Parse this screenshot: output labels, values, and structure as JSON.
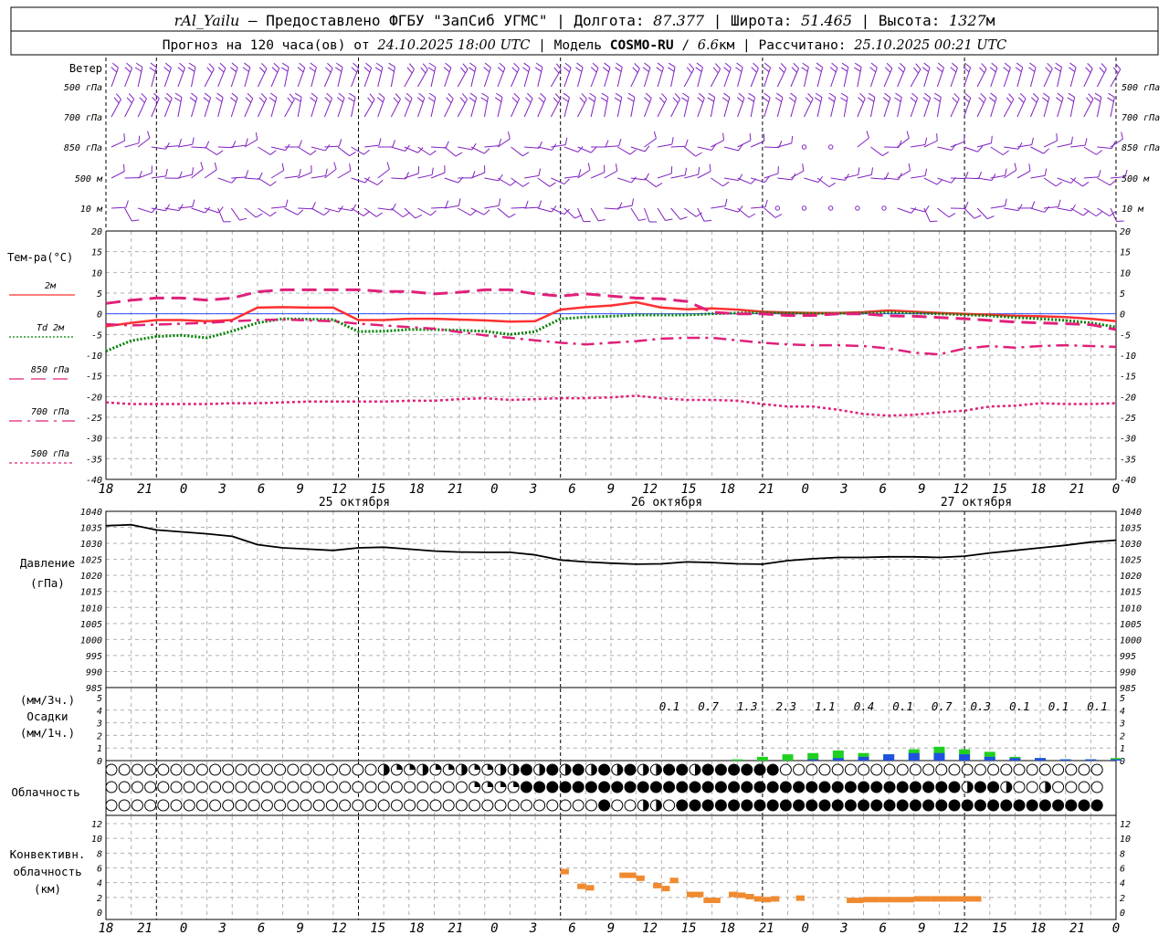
{
  "header": {
    "line1": [
      {
        "t": "rAl_Yailu",
        "style": "ital"
      },
      {
        "t": " – Предоставлено ФГБУ \"ЗапСиб УГМС\" | Долгота: ",
        "style": ""
      },
      {
        "t": "87.377",
        "style": "ital"
      },
      {
        "t": " | Широта: ",
        "style": ""
      },
      {
        "t": "51.465",
        "style": "ital"
      },
      {
        "t": " | Высота: ",
        "style": ""
      },
      {
        "t": "1327",
        "style": "ital"
      },
      {
        "t": "м",
        "style": ""
      }
    ],
    "line2": [
      {
        "t": "Прогноз на 120 часа(ов) от ",
        "style": ""
      },
      {
        "t": "24.10.2025 18:00 UTC",
        "style": "ital"
      },
      {
        "t": "  | Модель ",
        "style": ""
      },
      {
        "t": "COSMO-RU",
        "style": "boldt"
      },
      {
        "t": " / ",
        "style": ""
      },
      {
        "t": "6.6",
        "style": "ital"
      },
      {
        "t": "км | Рассчитано: ",
        "style": ""
      },
      {
        "t": "25.10.2025 00:21 UTC",
        "style": "ital"
      }
    ]
  },
  "time_axis": {
    "hour_labels": [
      "18",
      "21",
      "0",
      "3",
      "6",
      "9",
      "12",
      "15",
      "18",
      "21",
      "0",
      "3",
      "6",
      "9",
      "12",
      "15",
      "18",
      "21",
      "0",
      "3",
      "6",
      "9",
      "12",
      "15",
      "18",
      "21",
      "0"
    ],
    "day_labels": [
      "25 октября",
      "26 октября",
      "27 октября"
    ]
  },
  "wind_panel": {
    "title": "Ветер",
    "levels": [
      "500 гПа",
      "700 гПа",
      "850 гПа",
      "500 м",
      "10  м"
    ],
    "color": "#8020c0"
  },
  "temperature_panel": {
    "title": "Тем-ра(°C)",
    "ylim": [
      -40,
      20
    ],
    "yticks": [
      "20",
      "15",
      "10",
      "5",
      "0",
      "-5",
      "-10",
      "-15",
      "-20",
      "-25",
      "-30",
      "-35",
      "-40"
    ],
    "legend": [
      {
        "label": "2м",
        "color": "#ff3030",
        "dash": "solid"
      },
      {
        "label": "Td  2м",
        "color": "#008000",
        "dash": "dotted"
      },
      {
        "label": "850 гПа",
        "color": "#e0207a",
        "dash": "long"
      },
      {
        "label": "700 гПа",
        "color": "#e0207a",
        "dash": "dashdot"
      },
      {
        "label": "500 гПа",
        "color": "#e0207a",
        "dash": "dense"
      }
    ]
  },
  "pressure_panel": {
    "title": "Давление",
    "unit": "(гПа)",
    "ylim": [
      985,
      1040
    ],
    "yticks": [
      "1040",
      "1035",
      "1030",
      "1025",
      "1020",
      "1015",
      "1010",
      "1005",
      "1000",
      "995",
      "990",
      "985"
    ],
    "color": "#000000"
  },
  "precip_panel": {
    "unit3": "(мм/3ч.)",
    "title": "Осадки",
    "unit1": "(мм/1ч.)",
    "yticks": [
      "5",
      "4",
      "3",
      "2",
      "1",
      "0"
    ],
    "totals": [
      "0.1",
      "0.7",
      "1.3",
      "2.3",
      "1.1",
      "0.4",
      "0.1",
      "0.7",
      "0.3",
      "0.1",
      "0.1",
      "0.1"
    ]
  },
  "cloud_panel": {
    "title": "Облачность"
  },
  "convective_panel": {
    "title_line1": "Конвективн.",
    "title_line2": "облачность",
    "unit": "(км)",
    "yticks": [
      "12",
      "10",
      "8",
      "6",
      "4",
      "2",
      "0"
    ],
    "color": "#f08a30"
  },
  "chart_data": [
    {
      "type": "line",
      "title": "Тем-ра(°C)",
      "x_hours": [
        0,
        3,
        6,
        9,
        12,
        15,
        18,
        21,
        24,
        27,
        30,
        33,
        36,
        39,
        42,
        45,
        48,
        51,
        54,
        57,
        60,
        63,
        66,
        69,
        72,
        75,
        78,
        81,
        84,
        87,
        90,
        93,
        96,
        99,
        102,
        105,
        108,
        111,
        114,
        117,
        120
      ],
      "ylim": [
        -40,
        20
      ],
      "series": [
        {
          "name": "2м",
          "values": [
            -3,
            -2.2,
            -1.5,
            -1.5,
            -1.8,
            -1.5,
            1.5,
            1.6,
            1.5,
            1.5,
            -1.5,
            -1.5,
            -1.2,
            -1.2,
            -1.4,
            -1.6,
            -1.9,
            -1.8,
            1,
            1.6,
            2,
            2.8,
            1.5,
            1.1,
            1.3,
            1.0,
            0.5,
            0.3,
            0.2,
            0.2,
            0.4,
            0.8,
            0.5,
            0.2,
            0,
            -0.2,
            -0.5,
            -0.6,
            -0.8,
            -1.2,
            -1.8
          ]
        },
        {
          "name": "Td  2м",
          "values": [
            -9,
            -6.5,
            -5.5,
            -5.2,
            -5.8,
            -4.2,
            -2.2,
            -1.2,
            -1.3,
            -1.4,
            -4.3,
            -4.2,
            -3.8,
            -3.8,
            -4.0,
            -4.2,
            -5,
            -4.3,
            -1.2,
            -0.8,
            -0.6,
            -0.3,
            -0.3,
            -0.3,
            0,
            0.2,
            0.3,
            0.2,
            0.1,
            0.1,
            0.2,
            0.4,
            0.2,
            0,
            -0.2,
            -0.5,
            -0.9,
            -1.2,
            -1.6,
            -2.2,
            -3.2
          ]
        },
        {
          "name": "850 гПа",
          "values": [
            2.5,
            3.3,
            3.8,
            3.8,
            3.3,
            3.8,
            5.3,
            5.8,
            5.8,
            5.8,
            5.8,
            5.4,
            5.4,
            4.8,
            5.2,
            5.8,
            5.8,
            4.8,
            4.3,
            4.8,
            4.3,
            3.8,
            3.6,
            3.0,
            0.4,
            0,
            0,
            -0.4,
            -0.4,
            0,
            0,
            -0.5,
            -0.6,
            -0.9,
            -1.2,
            -1.6,
            -2,
            -2.2,
            -2.4,
            -2.6,
            -3.8
          ]
        },
        {
          "name": "700 гПа",
          "values": [
            -2.5,
            -2.8,
            -2.6,
            -2.4,
            -2.2,
            -1.8,
            -1.5,
            -1.4,
            -1.6,
            -1.8,
            -2.4,
            -2.8,
            -3.2,
            -3.6,
            -4.4,
            -5.2,
            -5.8,
            -6.4,
            -7,
            -7.4,
            -7,
            -6.6,
            -6.0,
            -5.8,
            -5.8,
            -6.4,
            -7,
            -7.4,
            -7.6,
            -7.6,
            -7.8,
            -8.4,
            -9.4,
            -9.8,
            -8.4,
            -7.8,
            -8.2,
            -7.8,
            -7.6,
            -7.8,
            -8.0
          ]
        },
        {
          "name": "500 гПа",
          "values": [
            -21.4,
            -21.8,
            -21.8,
            -21.8,
            -21.8,
            -21.6,
            -21.6,
            -21.4,
            -21.2,
            -21.2,
            -21.2,
            -21.2,
            -21.0,
            -21.0,
            -20.6,
            -20.4,
            -20.8,
            -20.6,
            -20.4,
            -20.4,
            -20.2,
            -19.8,
            -20.4,
            -20.8,
            -20.8,
            -21.0,
            -21.8,
            -22.4,
            -22.4,
            -23.2,
            -24.2,
            -24.6,
            -24.4,
            -23.8,
            -23.4,
            -22.4,
            -22.2,
            -21.6,
            -21.8,
            -21.8,
            -21.6
          ]
        }
      ]
    },
    {
      "type": "line",
      "title": "Давление",
      "x_hours": [
        0,
        3,
        6,
        9,
        12,
        15,
        18,
        21,
        24,
        27,
        30,
        33,
        36,
        39,
        42,
        45,
        48,
        51,
        54,
        57,
        60,
        63,
        66,
        69,
        72,
        75,
        78,
        81,
        84,
        87,
        90,
        93,
        96,
        99,
        102,
        105,
        108,
        111,
        114,
        117,
        120
      ],
      "ylim": [
        985,
        1040
      ],
      "series": [
        {
          "name": "Давление",
          "values": [
            1035.5,
            1035.8,
            1034.2,
            1033.6,
            1033.0,
            1032.2,
            1029.6,
            1028.6,
            1028.2,
            1027.8,
            1028.6,
            1028.8,
            1028.2,
            1027.6,
            1027.3,
            1027.2,
            1027.2,
            1026.4,
            1024.8,
            1024.2,
            1023.8,
            1023.5,
            1023.6,
            1024.2,
            1024.0,
            1023.6,
            1023.5,
            1024.6,
            1025.2,
            1025.6,
            1025.6,
            1025.8,
            1025.8,
            1025.6,
            1026.0,
            1027.0,
            1027.8,
            1028.6,
            1029.4,
            1030.4,
            1031.0
          ]
        }
      ]
    },
    {
      "type": "bar",
      "title": "Осадки",
      "x_hours": [
        72,
        75,
        78,
        81,
        84,
        87,
        90,
        93,
        96,
        99,
        102,
        105,
        108,
        111,
        114,
        117,
        120
      ],
      "ylim": [
        0,
        5
      ],
      "series": [
        {
          "name": "green",
          "values": [
            0,
            0.1,
            0.3,
            0.5,
            0.6,
            0.8,
            0.6,
            0.5,
            0.9,
            1.1,
            0.9,
            0.7,
            0.3,
            0.2,
            0.1,
            0.1,
            0.2
          ]
        },
        {
          "name": "blue",
          "values": [
            0,
            0,
            0,
            0,
            0.1,
            0.2,
            0.3,
            0.5,
            0.6,
            0.6,
            0.5,
            0.3,
            0.2,
            0.2,
            0.1,
            0.1,
            0.1
          ]
        }
      ]
    },
    {
      "type": "bar",
      "title": "Конвективн. облачность",
      "ylim": [
        0,
        12
      ],
      "series": [
        {
          "name": "конвективная облачность",
          "segments": [
            [
              54,
              55,
              5.5
            ],
            [
              56,
              57,
              3.5
            ],
            [
              57,
              58,
              3.3
            ],
            [
              61,
              63,
              5.0
            ],
            [
              63,
              64,
              4.6
            ],
            [
              65,
              66,
              3.6
            ],
            [
              66,
              67,
              3.2
            ],
            [
              67,
              68,
              4.3
            ],
            [
              69,
              71,
              2.4
            ],
            [
              71,
              73,
              1.6
            ],
            [
              74,
              75,
              2.4
            ],
            [
              75,
              76,
              2.3
            ],
            [
              76,
              77,
              2.1
            ],
            [
              77,
              78,
              1.8
            ],
            [
              78,
              79,
              1.7
            ],
            [
              79,
              80,
              1.8
            ],
            [
              82,
              83,
              1.9
            ],
            [
              88,
              90,
              1.6
            ],
            [
              90,
              92,
              1.7
            ],
            [
              92,
              96,
              1.7
            ],
            [
              96,
              98,
              1.8
            ],
            [
              98,
              100,
              1.8
            ],
            [
              100,
              104,
              1.8
            ]
          ]
        }
      ]
    }
  ]
}
